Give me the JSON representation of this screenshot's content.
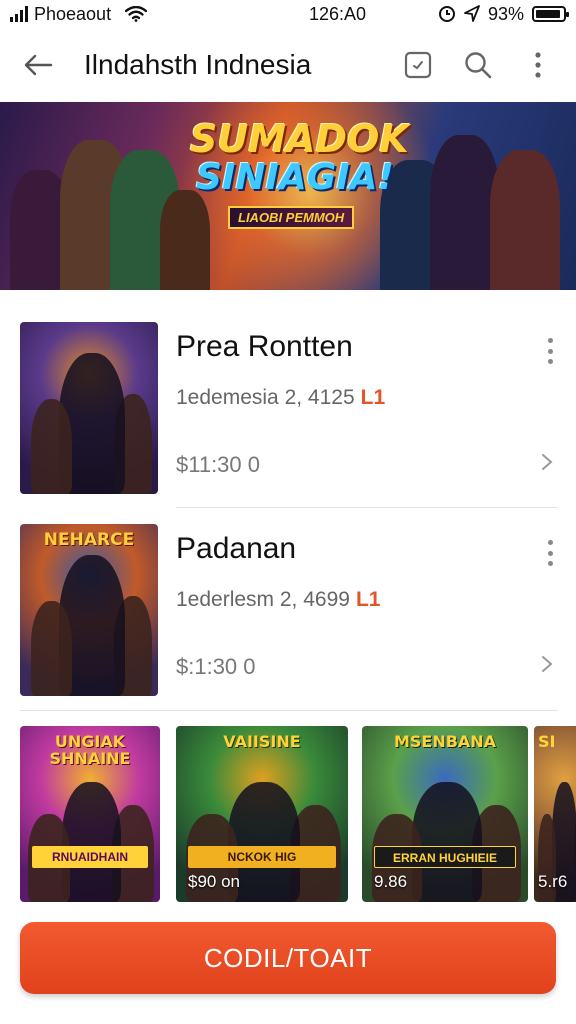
{
  "status_bar": {
    "carrier": "Phoeaout",
    "time": "126:A0",
    "battery": "93%",
    "battery_level": 0.93
  },
  "header": {
    "title": "Ilndahsth Indnesia"
  },
  "banner": {
    "headline_line1": "SUMADOK",
    "headline_line2": "SINIAGIA!",
    "tagline": "LIAOBI PEMMOH"
  },
  "list": [
    {
      "name": "Prea Rontten",
      "subtitle": "1edemesia 2, 4125",
      "flag": "L1",
      "price": "$11:30 0",
      "thumb_label": "",
      "thumb_colors": [
        "#2a1a4a",
        "#5a3a8a",
        "#e08a2a"
      ]
    },
    {
      "name": "Padanan",
      "subtitle": "1ederlesm 2, 4699",
      "flag": "L1",
      "price": "$:1:30 0",
      "thumb_label": "NEHARCE",
      "thumb_colors": [
        "#3a2a5a",
        "#c05a2a",
        "#3a5aa0"
      ]
    }
  ],
  "tiles": [
    {
      "label": "UNGIAK SHNAINE",
      "plate": "RNUAIDHAIN",
      "price": "",
      "colors": [
        "#5a1a6a",
        "#c03aa0",
        "#f0b030"
      ]
    },
    {
      "label": "VAIISINE",
      "plate": "NCKOK HIG",
      "price": "$90 on",
      "colors": [
        "#1a3a2a",
        "#3a8a3a",
        "#e0a020"
      ]
    },
    {
      "label": "MSENBANA",
      "plate": "ERRAN HUGHIEIE",
      "price": "9.86",
      "colors": [
        "#2a4a2a",
        "#5aa04a",
        "#3a6ac0"
      ]
    },
    {
      "label": "SI",
      "plate": "",
      "price": "5.r6",
      "colors": [
        "#3a2a1a",
        "#a06a3a",
        "#e0a040"
      ]
    }
  ],
  "cta": {
    "label": "CODIL/TOAIT"
  },
  "icons": {
    "back": "arrow-left-icon",
    "box": "box-icon",
    "search": "search-icon",
    "more": "more-vertical-icon",
    "chevron": "chevron-right-icon"
  },
  "colors": {
    "accent": "#e84a22",
    "flag": "#e2542a"
  }
}
